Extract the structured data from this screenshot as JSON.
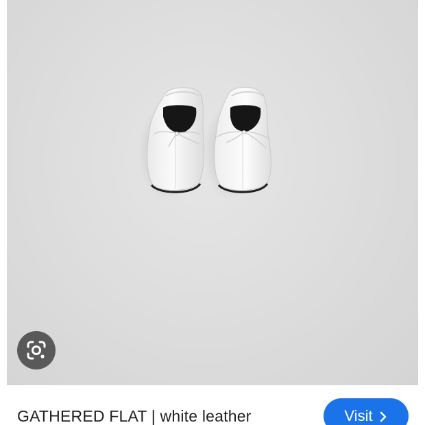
{
  "image": {
    "subject": "white leather gathered ballet flats with bow detail"
  },
  "lens_button": {
    "icon": "google-lens-icon"
  },
  "product": {
    "title": "GATHERED FLAT | white leather"
  },
  "visit_button": {
    "label": "Visit",
    "icon": "chevron-right-icon",
    "color": "#1a73e8"
  }
}
